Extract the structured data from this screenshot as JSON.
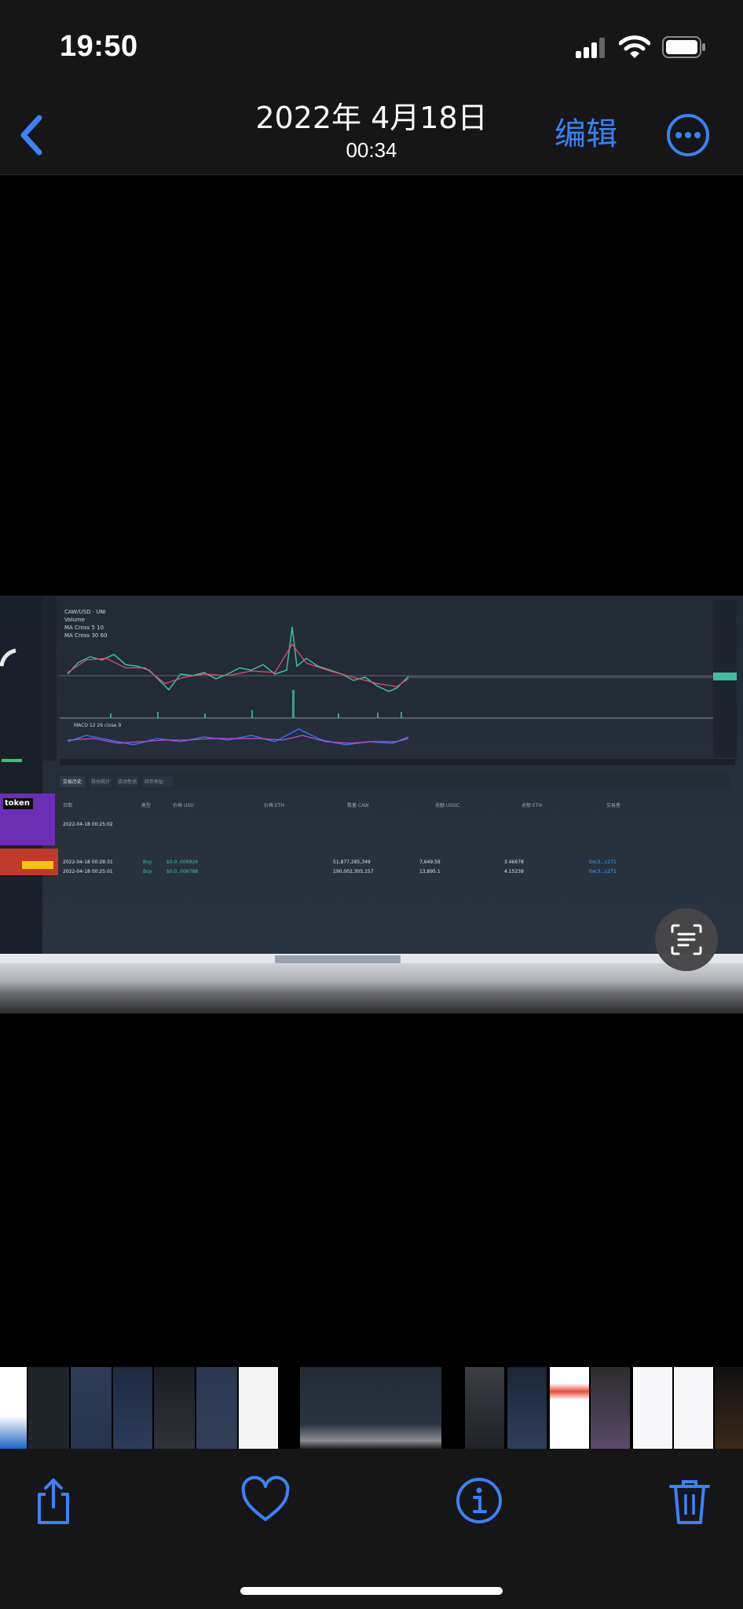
{
  "status_bar": {
    "time": "19:50"
  },
  "nav": {
    "date": "2022年 4月18日",
    "time": "00:34",
    "edit_label": "编辑"
  },
  "photo_text": {
    "pair": "CAW/USD · UNI",
    "volume": "Volume",
    "ma1": "MA Cross 5 10",
    "ma2": "MA Cross 30 60",
    "macd": "MACD 12 26 close 9",
    "tab_active": "交易历史",
    "tab_2": "持仓统计",
    "tab_3": "流动性池",
    "tab_4": "持币地址",
    "col_time": "日期",
    "col_type": "类型",
    "col_price_usd": "价格 USD",
    "col_price_eth": "价格 ETH",
    "col_amount": "数量 CAW",
    "col_usdc": "总额 USDC",
    "col_eth": "总额 ETH",
    "col_maker": "交易者",
    "row1_time": "2022-04-18 00:25:02",
    "row2_time": "2022-04-18 00:28:31",
    "row3_time": "2022-04-18 00:25:01",
    "row2_type": "Buy",
    "row3_type": "Buy",
    "row2_price": "$0.0..006826",
    "row3_price": "$0.0..006788",
    "row2_amount": "51,877,285,349",
    "row3_amount": "190,002,305,157",
    "row2_usdc": "7,649.59",
    "row3_usdc": "13,895.1",
    "row2_eth": "3.46678",
    "row3_eth": "4.15239",
    "row2_addr": "0xc3...c271",
    "row3_addr": "0xc3...c271",
    "promo_title": "token"
  },
  "colors": {
    "accent": "#3a82f7",
    "bar_bg": "#161616"
  },
  "icons": {
    "back": "chevron-left-icon",
    "more": "ellipsis-circle-icon",
    "share": "share-icon",
    "favorite": "heart-icon",
    "info": "info-icon",
    "delete": "trash-icon",
    "live_text": "live-text-icon"
  }
}
